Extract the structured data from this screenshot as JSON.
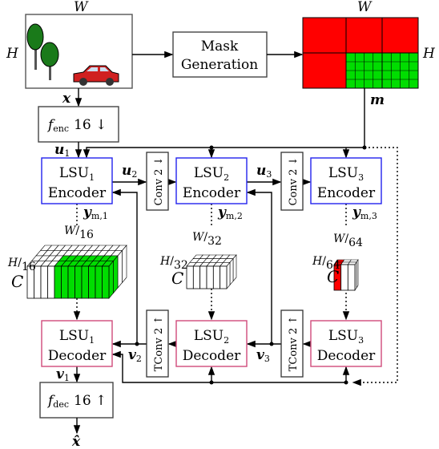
{
  "input_image": {
    "width_label": "W",
    "height_label": "H",
    "signal": "x"
  },
  "mask_generation": {
    "line1": "Mask",
    "line2": "Generation"
  },
  "mask": {
    "width_label": "W",
    "height_label": "H",
    "signal": "m",
    "colors": {
      "masked": "#ff0000",
      "unmasked": "#00dd00"
    }
  },
  "f_enc": {
    "name": "f",
    "sub": "enc",
    "op": "16 ↓"
  },
  "f_dec": {
    "name": "f",
    "sub": "dec",
    "op": "16 ↑"
  },
  "output": {
    "signal": "x̂"
  },
  "encoders": [
    {
      "name": "LSU",
      "sub": "1",
      "role": "Encoder",
      "input": "u",
      "input_sub": "1",
      "latent": "y",
      "latent_sub": "m,1"
    },
    {
      "name": "LSU",
      "sub": "2",
      "role": "Encoder",
      "input": "u",
      "input_sub": "2",
      "latent": "y",
      "latent_sub": "m,2"
    },
    {
      "name": "LSU",
      "sub": "3",
      "role": "Encoder",
      "input": "u",
      "input_sub": "3",
      "latent": "y",
      "latent_sub": "m,3"
    }
  ],
  "decoders": [
    {
      "name": "LSU",
      "sub": "1",
      "role": "Decoder",
      "output": "v",
      "output_sub": "1"
    },
    {
      "name": "LSU",
      "sub": "2",
      "role": "Decoder",
      "output": "v",
      "output_sub": "2"
    },
    {
      "name": "LSU",
      "sub": "3",
      "role": "Decoder",
      "output": "v",
      "output_sub": "3"
    }
  ],
  "conv_label": "Conv 2 ↓",
  "tconv_label": "TConv 2 ↑",
  "latents": [
    {
      "w": "W",
      "w_div": "16",
      "h": "H",
      "h_div": "16",
      "c": "C"
    },
    {
      "w": "W",
      "w_div": "32",
      "h": "H",
      "h_div": "32",
      "c": "C"
    },
    {
      "w": "W",
      "w_div": "64",
      "h": "H",
      "h_div": "64",
      "c": "C"
    }
  ],
  "colors": {
    "encoder_border": "#2222ee",
    "decoder_border": "#d04a7a"
  }
}
